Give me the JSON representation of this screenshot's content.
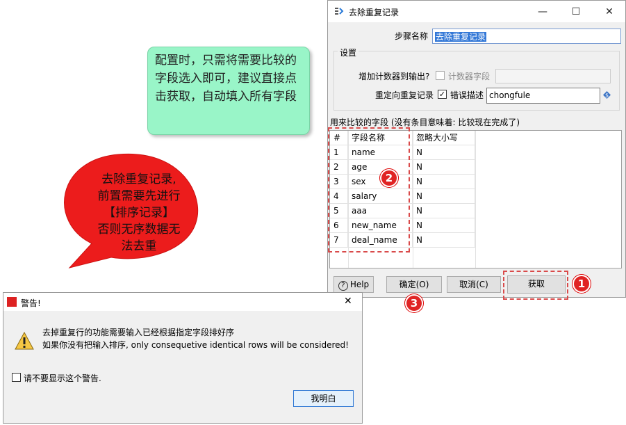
{
  "main_dialog": {
    "title": "去除重复记录",
    "window_controls": [
      "—",
      "☐",
      "✕"
    ],
    "step_name_label": "步骤名称",
    "step_name_value": "去除重复记录",
    "settings": {
      "group_title": "设置",
      "add_counter_label": "增加计数器到输出?",
      "counter_field_label": "计数器字段",
      "counter_field_value": "",
      "redirect_label": "重定向重复记录",
      "error_desc_label": "错误描述",
      "error_desc_value": "chongfule"
    },
    "fields_caption": "用来比较的字段 (没有条目意味着: 比较现在完成了)",
    "grid": {
      "headers": [
        "#",
        "字段名称",
        "忽略大小写"
      ],
      "rows": [
        {
          "num": "1",
          "name": "name",
          "ignore": "N"
        },
        {
          "num": "2",
          "name": "age",
          "ignore": "N"
        },
        {
          "num": "3",
          "name": "sex",
          "ignore": "N"
        },
        {
          "num": "4",
          "name": "salary",
          "ignore": "N"
        },
        {
          "num": "5",
          "name": "aaa",
          "ignore": "N"
        },
        {
          "num": "6",
          "name": "new_name",
          "ignore": "N"
        },
        {
          "num": "7",
          "name": "deal_name",
          "ignore": "N"
        }
      ]
    },
    "buttons": {
      "help": "Help",
      "ok": "确定(O)",
      "cancel": "取消(C)",
      "get": "获取"
    }
  },
  "annotations": {
    "green_note": "配置时，只需将需要比较的字段选入即可，建议直接点击获取，自动填入所有字段",
    "red_bubble_lines": [
      "去除重复记录,",
      "前置需要先进行",
      "【排序记录】",
      "否则无序数据无",
      "法去重"
    ],
    "badges": [
      "1",
      "2",
      "3"
    ]
  },
  "warning_dialog": {
    "title": "警告!",
    "close": "✕",
    "line1": "去掉重复行的功能需要输入已经根据指定字段排好序",
    "line2": "如果你没有把输入排序, only consequetive identical rows will be considered!",
    "dont_show_label": "请不要显示这个警告.",
    "ack_button": "我明白"
  },
  "colors": {
    "note_green": "#99f5c8",
    "bubble_red": "#ec1c1c",
    "badge_red": "#e02424",
    "selection_blue": "#3378d7"
  }
}
